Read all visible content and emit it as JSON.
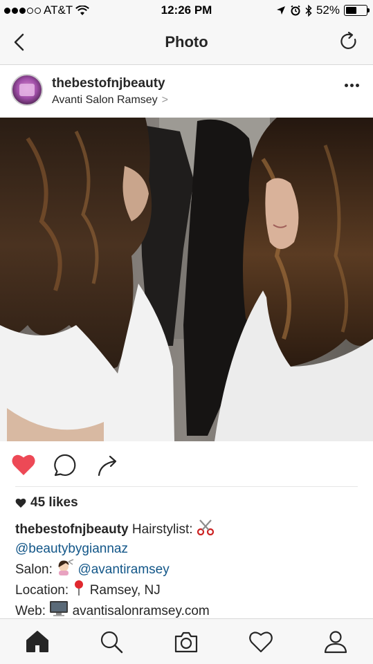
{
  "status_bar": {
    "carrier": "AT&T",
    "time": "12:26 PM",
    "battery": "52%",
    "battery_level": 0.52,
    "signal_bars_filled": 3,
    "signal_bars_total": 5
  },
  "nav": {
    "title": "Photo",
    "back_icon": "chevron-left-icon",
    "refresh_icon": "refresh-icon"
  },
  "post": {
    "username": "thebestofnjbeauty",
    "location": "Avanti Salon Ramsey",
    "location_chevron": ">",
    "likes": "45 likes",
    "liked": true,
    "like_color": "#ed4956",
    "caption": {
      "username": "thebestofnjbeauty",
      "line1_text": "Hairstylist:",
      "mention1": "@beautybygiannaz",
      "salon_label": "Salon:",
      "mention2": "@avantiramsey",
      "location_label": "Location:",
      "location_value": "Ramsey, NJ",
      "web_label": "Web:",
      "web_value": "avantisalonramsey.com"
    }
  },
  "tabs": [
    {
      "name": "home",
      "icon": "home-icon",
      "active": true
    },
    {
      "name": "search",
      "icon": "search-icon",
      "active": false
    },
    {
      "name": "camera",
      "icon": "camera-icon",
      "active": false
    },
    {
      "name": "activity",
      "icon": "heart-icon",
      "active": false
    },
    {
      "name": "profile",
      "icon": "profile-icon",
      "active": false
    }
  ],
  "colors": {
    "link": "#125688",
    "text": "#262626",
    "bar_bg": "#f7f7f7"
  }
}
